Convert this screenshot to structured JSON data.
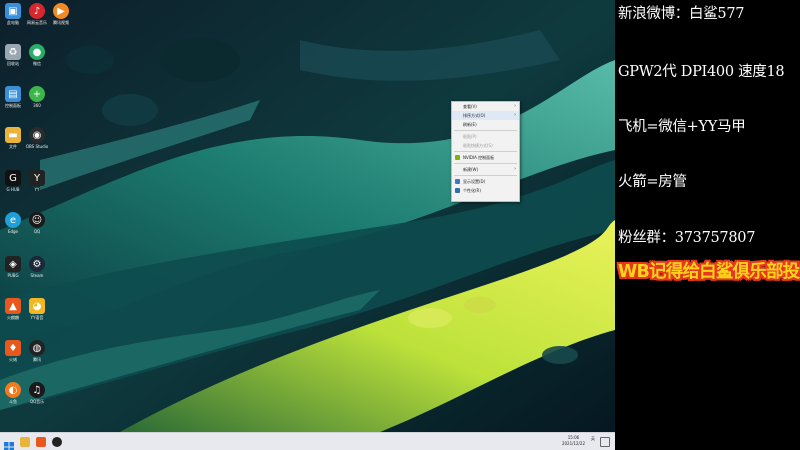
{
  "overlay": {
    "weibo": "新浪微博：白鲨577",
    "gear": "GPW2代 DPI400 速度18",
    "plane": "飞机=微信+YY马甲",
    "rocket": "火箭=房管",
    "fans": "粉丝群：373757807",
    "banner": "WB记得给白鲨俱乐部投票"
  },
  "context_menu": {
    "items": [
      {
        "label": "查看(V)",
        "submenu": true
      },
      {
        "label": "排序方式(O)",
        "submenu": true
      },
      {
        "label": "刷新(E)",
        "submenu": false
      },
      {
        "label": "粘贴(P)",
        "submenu": false,
        "disabled": true
      },
      {
        "label": "粘贴快捷方式(S)",
        "submenu": false,
        "disabled": true
      },
      {
        "label": "NVIDIA 控制面板",
        "submenu": false
      },
      {
        "label": "新建(W)",
        "submenu": true
      },
      {
        "label": "显示设置(D)",
        "submenu": false
      },
      {
        "label": "个性化(R)",
        "submenu": false
      }
    ]
  },
  "desktop_icons": [
    {
      "label": "此电脑",
      "icon": "computer-icon",
      "color": "#3b8fd9"
    },
    {
      "label": "网易云音乐",
      "icon": "music-icon",
      "color": "#d8262e"
    },
    {
      "label": "腾讯视频",
      "icon": "video-icon",
      "color": "#f08a24"
    },
    {
      "label": "回收站",
      "icon": "recycle-bin-icon",
      "color": "#9aa6b2"
    },
    {
      "label": "微信",
      "icon": "wechat-icon",
      "color": "#2aae67"
    },
    {
      "label": "控制面板",
      "icon": "control-panel-icon",
      "color": "#3a8fd6"
    },
    {
      "label": "360",
      "icon": "security-icon",
      "color": "#3cb649"
    },
    {
      "label": "文件",
      "icon": "folder-icon",
      "color": "#e9b43c"
    },
    {
      "label": "OBS Studio",
      "icon": "obs-icon",
      "color": "#2b2b2b"
    },
    {
      "label": "G HUB",
      "icon": "logitech-icon",
      "color": "#111111"
    },
    {
      "label": "YY",
      "icon": "yy-icon",
      "color": "#222222"
    },
    {
      "label": "Edge",
      "icon": "edge-icon",
      "color": "#1f9ed8"
    },
    {
      "label": "QQ",
      "icon": "qq-icon",
      "color": "#1a1a1a"
    },
    {
      "label": "PUBG",
      "icon": "game-icon",
      "color": "#222222"
    },
    {
      "label": "Steam",
      "icon": "steam-icon",
      "color": "#1b2838"
    },
    {
      "label": "火麒麟",
      "icon": "fire-icon",
      "color": "#e8581c"
    },
    {
      "label": "YY语音",
      "icon": "yy-voice-icon",
      "color": "#f2b824"
    },
    {
      "label": "火绒",
      "icon": "shield-icon",
      "color": "#e8581c"
    },
    {
      "label": "腾讯",
      "icon": "tencent-icon",
      "color": "#222222"
    },
    {
      "label": "斗鱼",
      "icon": "douyu-icon",
      "color": "#f2791c"
    },
    {
      "label": "QQ音乐",
      "icon": "qq-music-icon",
      "color": "#1a1a1a"
    }
  ],
  "taskbar": {
    "time": "15:06",
    "date": "2021/12/22",
    "tray_text": "英"
  },
  "colors": {
    "banner_fill": "#ffd21a",
    "banner_outline": "#e6381f"
  }
}
